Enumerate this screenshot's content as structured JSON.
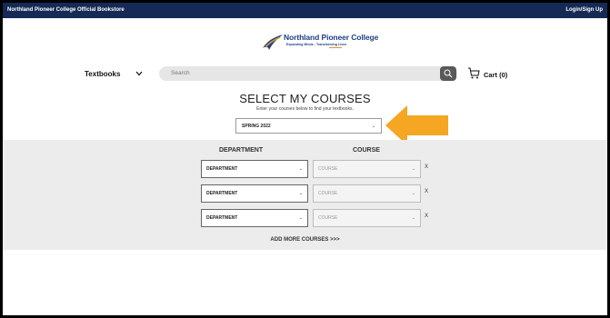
{
  "topbar": {
    "store_name": "Northland Pioneer College Official Bookstore",
    "login_label": "Login/Sign Up",
    "background": "#152a55"
  },
  "logo": {
    "name": "Northland Pioneer College",
    "tagline": "Expanding Minds - Transforming Lives"
  },
  "nav": {
    "textbooks_label": "Textbooks",
    "search_placeholder": "Search",
    "cart_label": "Cart (0)"
  },
  "courses": {
    "title": "SELECT MY COURSES",
    "subtitle": "Enter your courses below to find your textbooks.",
    "term_value": "SPRING 2022",
    "department_header": "DEPARTMENT",
    "course_header": "COURSE",
    "rows": [
      {
        "department": "DEPARTMENT",
        "course": "COURSE",
        "remove": "X"
      },
      {
        "department": "DEPARTMENT",
        "course": "COURSE",
        "remove": "X"
      },
      {
        "department": "DEPARTMENT",
        "course": "COURSE",
        "remove": "X"
      }
    ],
    "add_more_label": "ADD MORE COURSES >>>"
  },
  "colors": {
    "accent_arrow": "#f5a623",
    "brand_blue": "#1f3f85",
    "panel_gray": "#ececec"
  },
  "icons": {
    "search": "search-icon",
    "cart": "cart-icon",
    "chevron": "chevron-down-icon",
    "callout_arrow": "arrow-left-icon"
  }
}
